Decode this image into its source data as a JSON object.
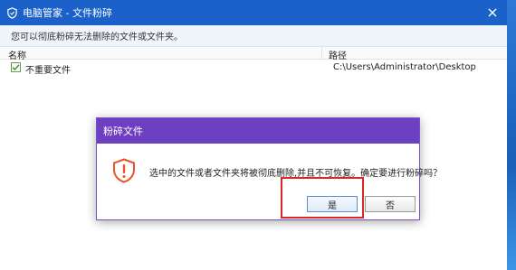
{
  "window": {
    "title": "电脑管家 - 文件粉碎",
    "info_text": "您可以彻底粉碎无法删除的文件或文件夹。",
    "close_symbol": "✕"
  },
  "list": {
    "headers": {
      "name": "名称",
      "path": "路径"
    },
    "rows": [
      {
        "checked": true,
        "name": "不重要文件",
        "path": "C:\\Users\\Administrator\\Desktop"
      }
    ]
  },
  "dialog": {
    "title": "粉碎文件",
    "message": "选中的文件或者文件夹将被彻底删除,并且不可恢复。确定要进行粉碎吗？",
    "yes_label": "是",
    "no_label": "否",
    "icon": "warning-icon"
  },
  "colors": {
    "titlebar": "#1b61c9",
    "dialog_titlebar": "#6d3fc1",
    "warning": "#e8542a",
    "highlight": "#d8262b"
  }
}
